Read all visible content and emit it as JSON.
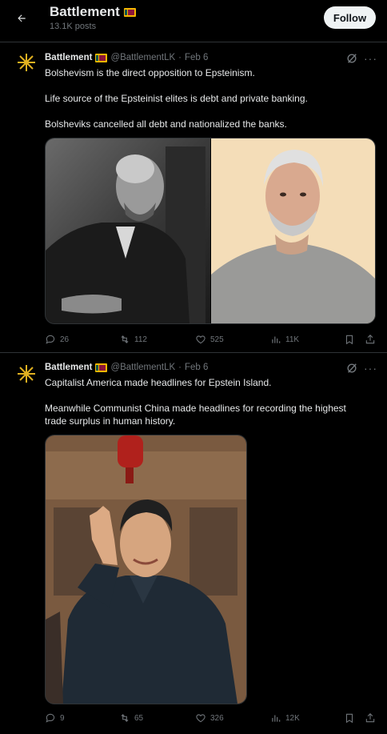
{
  "header": {
    "title": "Battlement",
    "posts_count": "13.1K posts",
    "follow_label": "Follow"
  },
  "posts": [
    {
      "name": "Battlement",
      "handle": "@BattlementLK",
      "date": "Feb 6",
      "lines": [
        "Bolshevism is the direct opposition to Epsteinism.",
        "Life source of the Epsteinist elites is debt and private banking.",
        "Bolsheviks cancelled all debt and nationalized the banks."
      ],
      "replies": "26",
      "reposts": "112",
      "likes": "525",
      "views": "11K"
    },
    {
      "name": "Battlement",
      "handle": "@BattlementLK",
      "date": "Feb 6",
      "lines": [
        "Capitalist America made headlines for Epstein Island.",
        "Meanwhile Communist China made headlines for recording the highest",
        "trade surplus in human history."
      ],
      "replies": "9",
      "reposts": "65",
      "likes": "326",
      "views": "12K"
    }
  ]
}
